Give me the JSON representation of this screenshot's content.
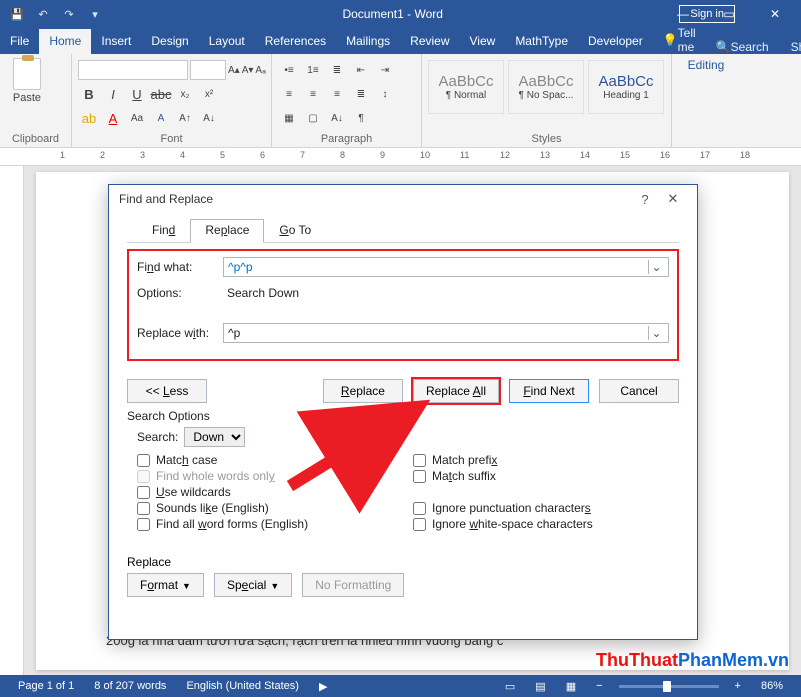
{
  "titlebar": {
    "doc": "Document1 - Word",
    "signin": "Sign in"
  },
  "tabs": [
    "File",
    "Home",
    "Insert",
    "Design",
    "Layout",
    "References",
    "Mailings",
    "Review",
    "View",
    "MathType",
    "Developer"
  ],
  "tabs_active": "Home",
  "tell": "Tell me",
  "search": "Search",
  "share": "Share",
  "ribbon": {
    "clipboard": "Clipboard",
    "paste": "Paste",
    "font": "Font",
    "para": "Paragraph",
    "styles": "Styles",
    "editing": "Editing",
    "style1": "¶ Normal",
    "style2": "¶ No Spac...",
    "style3": "Heading 1",
    "style_prev": "AaBbCc"
  },
  "ruler": [
    "1",
    "2",
    "3",
    "4",
    "5",
    "6",
    "7",
    "8",
    "9",
    "10",
    "11",
    "12",
    "13",
    "14",
    "15",
    "16",
    "17",
    "18"
  ],
  "dialog": {
    "title": "Find and Replace",
    "tab_find": "Find",
    "tab_replace": "Replace",
    "tab_goto": "Go To",
    "findwhat_lbl": "Find what:",
    "findwhat_val": "^p^p",
    "options_lbl": "Options:",
    "options_val": "Search Down",
    "replacewith_lbl": "Replace with:",
    "replacewith_val": "^p",
    "less": "<< Less",
    "btn_replace": "Replace",
    "btn_replace_all": "Replace All",
    "btn_find_next": "Find Next",
    "btn_cancel": "Cancel",
    "so_hd": "Search Options",
    "so_search": "Search:",
    "so_dir": "Down",
    "chk_match_case": "Match case",
    "chk_whole": "Find whole words only",
    "chk_wild": "Use wildcards",
    "chk_sounds": "Sounds like (English)",
    "chk_allforms": "Find all word forms (English)",
    "chk_prefix": "Match prefix",
    "chk_suffix": "Match suffix",
    "chk_punct": "Ignore punctuation characters",
    "chk_white": "Ignore white-space characters",
    "replace_lbl": "Replace",
    "btn_format": "Format",
    "btn_special": "Special",
    "btn_nofmt": "No Formatting"
  },
  "page_text_1": "200g lá nha đam tươi rửa sạch, rạch trên lá nhiều hình vuông bằng c",
  "status": {
    "page": "Page 1 of 1",
    "words": "8 of 207 words",
    "lang": "English (United States)",
    "zoom": "86%"
  },
  "watermark_a": "ThuThuat",
  "watermark_b": "PhanMem.vn"
}
